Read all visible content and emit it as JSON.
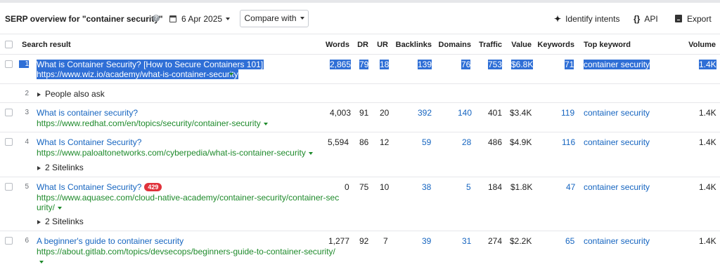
{
  "toolbar": {
    "title": "SERP overview for \"container security\"",
    "help_icon": "?",
    "date": "6 Apr 2025",
    "compare_label": "Compare with",
    "identify_label": "Identify intents",
    "api_label": "API",
    "api_icon": "{}",
    "export_label": "Export"
  },
  "columns": {
    "search_result": "Search result",
    "words": "Words",
    "dr": "DR",
    "ur": "UR",
    "backlinks": "Backlinks",
    "domains": "Domains",
    "traffic": "Traffic",
    "value": "Value",
    "keywords": "Keywords",
    "top_keyword": "Top keyword",
    "volume": "Volume"
  },
  "rows": [
    {
      "pos": "1",
      "title": "What is Container Security? [How to Secure Containers 101]",
      "url": "https://www.wiz.io/academy/what-is-container-security",
      "words": "2,865",
      "dr": "79",
      "ur": "18",
      "backlinks": "139",
      "domains": "76",
      "traffic": "753",
      "value": "$6.8K",
      "keywords": "71",
      "top_keyword": "container security",
      "volume": "1.4K",
      "selected": true
    },
    {
      "pos": "2",
      "people_also_ask": "People also ask"
    },
    {
      "pos": "3",
      "title": "What is container security?",
      "url": "https://www.redhat.com/en/topics/security/container-security",
      "words": "4,003",
      "dr": "91",
      "ur": "20",
      "backlinks": "392",
      "domains": "140",
      "traffic": "401",
      "value": "$3.4K",
      "keywords": "119",
      "top_keyword": "container security",
      "volume": "1.4K"
    },
    {
      "pos": "4",
      "title": "What Is Container Security?",
      "url": "https://www.paloaltonetworks.com/cyberpedia/what-is-container-security",
      "sitelinks": "2 Sitelinks",
      "words": "5,594",
      "dr": "86",
      "ur": "12",
      "backlinks": "59",
      "domains": "28",
      "traffic": "486",
      "value": "$4.9K",
      "keywords": "116",
      "top_keyword": "container security",
      "volume": "1.4K"
    },
    {
      "pos": "5",
      "title": "What Is Container Security?",
      "badge": "429",
      "url_line1": "https://www.aquasec.com/cloud-native-academy/container-security/container-sec",
      "url_line2": "urity/",
      "sitelinks": "2 Sitelinks",
      "words": "0",
      "dr": "75",
      "ur": "10",
      "backlinks": "38",
      "domains": "5",
      "traffic": "184",
      "value": "$1.8K",
      "keywords": "47",
      "top_keyword": "container security",
      "volume": "1.4K"
    },
    {
      "pos": "6",
      "title": "A beginner's guide to container security",
      "url": "https://about.gitlab.com/topics/devsecops/beginners-guide-to-container-security/",
      "words": "1,277",
      "dr": "92",
      "ur": "7",
      "backlinks": "39",
      "domains": "31",
      "traffic": "274",
      "value": "$2.2K",
      "keywords": "65",
      "top_keyword": "container security",
      "volume": "1.4K"
    }
  ],
  "colors": {
    "link": "#1665c0",
    "url": "#1e8a2b",
    "selection": "#2f6fd6",
    "badge": "#e0323b"
  }
}
